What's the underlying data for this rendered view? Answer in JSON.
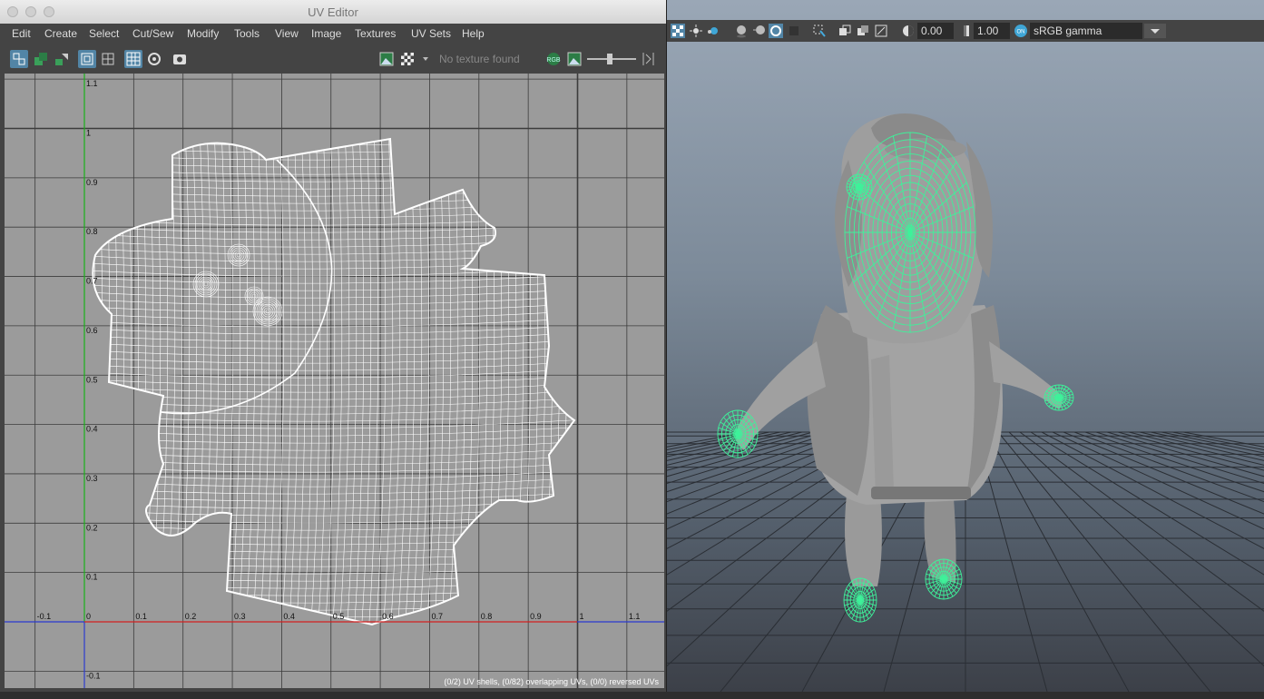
{
  "window": {
    "title": "UV Editor",
    "close_label": "",
    "minimize_label": "",
    "zoom_label": ""
  },
  "menu": [
    "Edit",
    "Create",
    "Select",
    "Cut/Sew",
    "Modify",
    "Tools",
    "View",
    "Image",
    "Textures",
    "UV Sets",
    "Help"
  ],
  "toolbar": {
    "texture_placeholder": "No texture found"
  },
  "uv_grid": {
    "x_ticks": [
      "-0.1",
      "0",
      "0.1",
      "0.2",
      "0.3",
      "0.4",
      "0.5",
      "0.6",
      "0.7",
      "0.8",
      "0.9",
      "1",
      "1.1"
    ],
    "y_ticks": [
      "1.1",
      "1",
      "0.9",
      "0.8",
      "0.7",
      "0.6",
      "0.5",
      "0.4",
      "0.3",
      "0.2",
      "0.1",
      "-0.1"
    ],
    "status": "(0/2) UV shells, (0/82) overlapping UVs, (0/0) reversed UVs"
  },
  "viewport": {
    "exposure": "0.00",
    "gamma": "1.00",
    "color_space": "sRGB gamma"
  },
  "colors": {
    "grid_bg": "#9b9b9b",
    "wire_green": "#3ef29a",
    "accent_blue": "#5285a6",
    "u_axis": "#d22020",
    "v_axis": "#19b219"
  }
}
